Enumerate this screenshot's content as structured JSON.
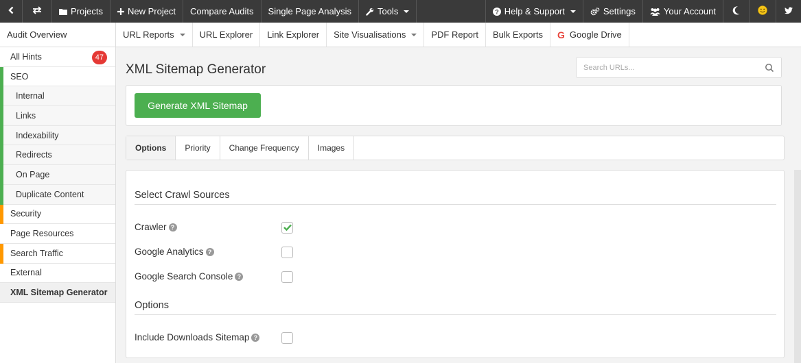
{
  "topbar": {
    "back_icon": "chevron-left-icon",
    "switch_icon": "swap-arrows-icon",
    "items": [
      {
        "label": "Projects",
        "icon": "folder-icon"
      },
      {
        "label": "New Project",
        "icon": "plus-icon"
      },
      {
        "label": "Compare Audits"
      },
      {
        "label": "Single Page Analysis"
      },
      {
        "label": "Tools",
        "icon": "wrench-icon",
        "dropdown": true
      }
    ],
    "right_items": [
      {
        "label": "Help & Support",
        "icon": "question-circle-icon",
        "dropdown": true
      },
      {
        "label": "Settings",
        "icon": "gears-icon"
      },
      {
        "label": "Your Account",
        "icon": "users-icon"
      }
    ],
    "dark_mode_icon": "moon-icon",
    "emoji_icon": "smiley-icon",
    "twitter_icon": "twitter-icon"
  },
  "subnav": {
    "overview": "Audit Overview",
    "items": [
      {
        "label": "URL Reports",
        "dropdown": true
      },
      {
        "label": "URL Explorer"
      },
      {
        "label": "Link Explorer"
      },
      {
        "label": "Site Visualisations",
        "dropdown": true
      },
      {
        "label": "PDF Report"
      },
      {
        "label": "Bulk Exports"
      },
      {
        "label": "Google Drive",
        "icon": "google-g-icon"
      }
    ],
    "google_icon_glyph": "G"
  },
  "sidebar": {
    "items": [
      {
        "label": "All Hints",
        "badge": "47",
        "sub": false,
        "color": ""
      },
      {
        "label": "SEO",
        "sub": false,
        "color": "#4caf50"
      },
      {
        "label": "Internal",
        "sub": true,
        "color": "#4caf50"
      },
      {
        "label": "Links",
        "sub": true,
        "color": "#4caf50"
      },
      {
        "label": "Indexability",
        "sub": true,
        "color": "#4caf50"
      },
      {
        "label": "Redirects",
        "sub": true,
        "color": "#4caf50"
      },
      {
        "label": "On Page",
        "sub": true,
        "color": "#4caf50"
      },
      {
        "label": "Duplicate Content",
        "sub": true,
        "color": "#4caf50"
      },
      {
        "label": "Security",
        "sub": false,
        "color": "#ff9800"
      },
      {
        "label": "Page Resources",
        "sub": false,
        "color": ""
      },
      {
        "label": "Search Traffic",
        "sub": false,
        "color": "#ff9800"
      },
      {
        "label": "External",
        "sub": false,
        "color": ""
      },
      {
        "label": "XML Sitemap Generator",
        "sub": false,
        "color": "",
        "active": true
      }
    ]
  },
  "main": {
    "title": "XML Sitemap Generator",
    "search_placeholder": "Search URLs...",
    "generate_button": "Generate XML Sitemap",
    "tabs": [
      {
        "label": "Options",
        "active": true
      },
      {
        "label": "Priority"
      },
      {
        "label": "Change Frequency"
      },
      {
        "label": "Images"
      }
    ],
    "crawl_sources": {
      "title": "Select Crawl Sources",
      "options": [
        {
          "label": "Crawler",
          "checked": true
        },
        {
          "label": "Google Analytics",
          "checked": false
        },
        {
          "label": "Google Search Console",
          "checked": false
        }
      ]
    },
    "options": {
      "title": "Options",
      "options": [
        {
          "label": "Include Downloads Sitemap",
          "checked": false
        }
      ]
    },
    "help_glyph": "?"
  },
  "colors": {
    "topbar_bg": "#3a3a3a",
    "accent_green": "#4caf50",
    "warning_orange": "#ff9800",
    "badge_red": "#e53935",
    "google_red": "#e8453c"
  }
}
